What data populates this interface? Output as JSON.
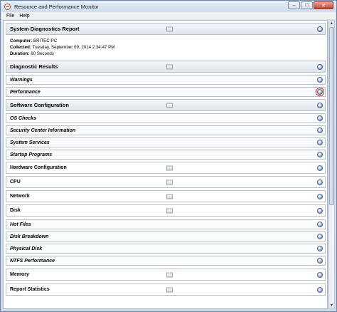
{
  "window": {
    "title": "Resource and Performance Monitor",
    "controls": [
      "–",
      "□",
      "✕"
    ]
  },
  "menu": {
    "file": "File",
    "help": "Help"
  },
  "report": {
    "title": "System Diagnostics Report",
    "computer_label": "Computer:",
    "computer_value": "BRITEC-PC",
    "collected_label": "Collected:",
    "collected_value": "Tuesday, September 09, 2014 2:34:47 PM",
    "duration_label": "Duration:",
    "duration_value": "60 Seconds"
  },
  "sections": {
    "diagnostic_results": "Diagnostic Results",
    "warnings": "Warnings",
    "performance": "Performance",
    "software_configuration": "Software Configuration",
    "os_checks": "OS Checks",
    "security_center": "Security Center Information",
    "system_services": "System Services",
    "startup_programs": "Startup Programs",
    "hardware_configuration": "Hardware Configuration",
    "cpu": "CPU",
    "network": "Network",
    "disk": "Disk",
    "hot_files": "Hot Files",
    "disk_breakdown": "Disk Breakdown",
    "physical_disk": "Physical Disk",
    "ntfs_performance": "NTFS Performance",
    "memory": "Memory",
    "report_statistics": "Report Statistics"
  },
  "colors": {
    "highlight": "#e02020",
    "toggle": "#4d6a90"
  }
}
